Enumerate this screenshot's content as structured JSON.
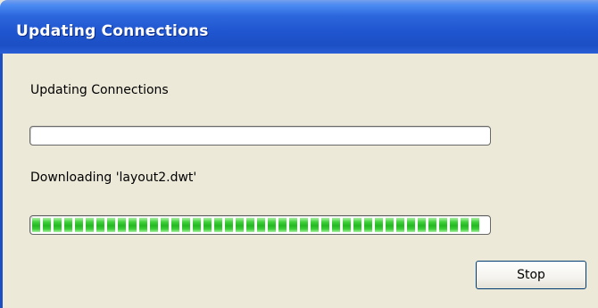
{
  "window": {
    "title": "Updating Connections"
  },
  "dialog": {
    "status_label": "Updating Connections",
    "overall_progress": 0,
    "file_label": "Downloading 'layout2.dwt'",
    "file_progress": 1.0,
    "stop_label": "Stop"
  },
  "colors": {
    "title_bar": "#1c4fc4",
    "progress_fill": "#25b822",
    "client_background": "#ece9d8"
  }
}
